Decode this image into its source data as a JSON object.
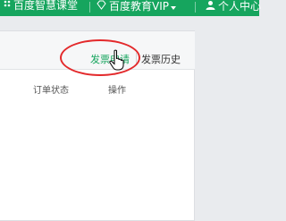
{
  "topbar": {
    "background": "#16a55e",
    "items": [
      {
        "label": "百度智慧课堂",
        "icon": "dots-icon"
      },
      {
        "label": "百度教育VIP",
        "icon": "diamond-icon",
        "dropdown": true
      },
      {
        "label": "个人中心",
        "icon": "user-icon"
      }
    ]
  },
  "invoice_panel": {
    "tabs": [
      {
        "label": "发票申请",
        "active": true,
        "color": "#16a55e"
      },
      {
        "label": "发票历史",
        "active": false
      }
    ],
    "columns": [
      "订单状态",
      "操作"
    ]
  },
  "annotation": {
    "shape": "ellipse",
    "color": "#e3292b",
    "target": "发票申请"
  },
  "cursor": {
    "type": "hand-pointer"
  }
}
